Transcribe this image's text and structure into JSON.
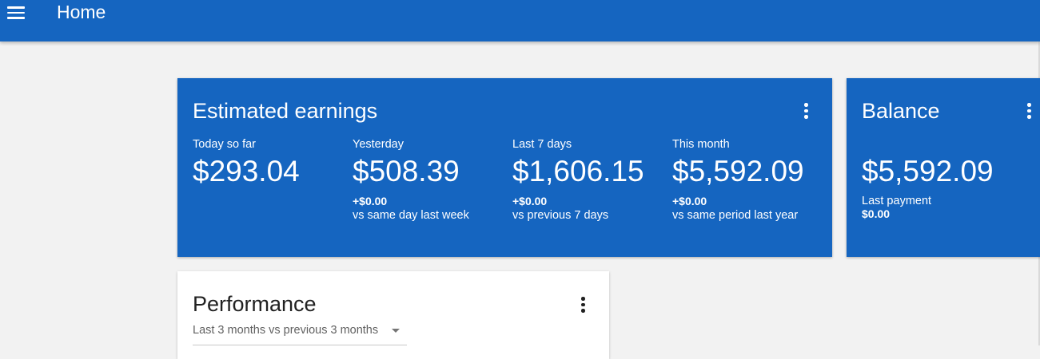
{
  "header": {
    "title": "Home",
    "menu_icon": "hamburger-menu-icon"
  },
  "colors": {
    "primary": "#1565c0",
    "background": "#f2f2f2",
    "card": "#ffffff"
  },
  "earnings": {
    "title": "Estimated earnings",
    "more_icon": "more-vert-icon",
    "metrics": [
      {
        "label": "Today so far",
        "value": "$293.04",
        "delta": "",
        "compare": ""
      },
      {
        "label": "Yesterday",
        "value": "$508.39",
        "delta": "+$0.00",
        "compare": "vs same day last week"
      },
      {
        "label": "Last 7 days",
        "value": "$1,606.15",
        "delta": "+$0.00",
        "compare": "vs previous 7 days"
      },
      {
        "label": "This month",
        "value": "$5,592.09",
        "delta": "+$0.00",
        "compare": "vs same period last year"
      }
    ]
  },
  "balance": {
    "title": "Balance",
    "value": "$5,592.09",
    "last_payment_label": "Last payment",
    "last_payment_value": "$0.00",
    "more_icon": "more-vert-icon"
  },
  "performance": {
    "title": "Performance",
    "range_selected": "Last 3 months vs previous 3 months",
    "more_icon": "more-vert-icon"
  }
}
